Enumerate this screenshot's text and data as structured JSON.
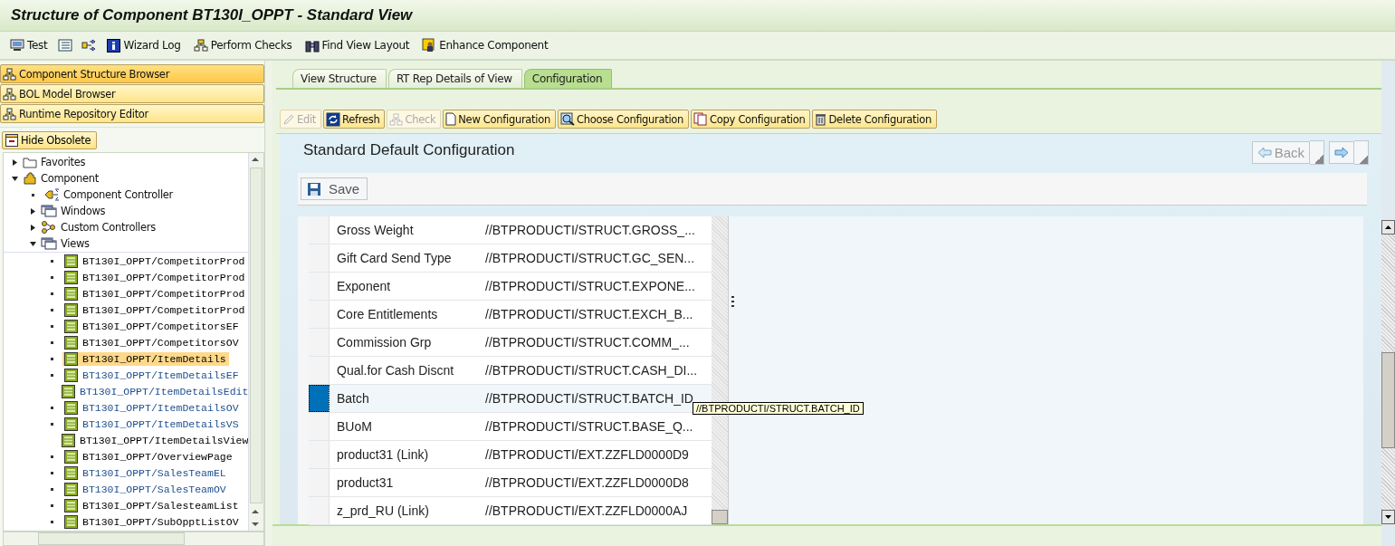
{
  "window": {
    "title": "Structure of Component BT130I_OPPT - Standard View"
  },
  "toolbar": [
    {
      "kind": "test",
      "label": "Test"
    },
    {
      "kind": "list"
    },
    {
      "kind": "flow"
    },
    {
      "kind": "info",
      "label": "Wizard Log"
    },
    {
      "kind": "checks",
      "label": "Perform Checks"
    },
    {
      "kind": "find",
      "label": "Find View Layout"
    },
    {
      "kind": "enhance",
      "label": "Enhance Component"
    }
  ],
  "nav": [
    {
      "label": "Component Structure Browser",
      "selected": true
    },
    {
      "label": "BOL Model Browser",
      "selected": false
    },
    {
      "label": "Runtime Repository Editor",
      "selected": false
    }
  ],
  "hide_button": {
    "label": "Hide Obsolete"
  },
  "tree": [
    {
      "label": "Favorites",
      "kind": "folder",
      "expanded": false
    },
    {
      "label": "Component",
      "kind": "component",
      "expanded": true,
      "children": [
        {
          "label": "Component Controller",
          "kind": "controller"
        },
        {
          "label": "Windows",
          "kind": "windows",
          "expanded": false
        },
        {
          "label": "Custom Controllers",
          "kind": "custom",
          "expanded": false
        },
        {
          "label": "Views",
          "kind": "windows",
          "expanded": true,
          "children": [
            {
              "label": "BT130I_OPPT/CompetitorProd",
              "kind": "view",
              "selected": false
            },
            {
              "label": "BT130I_OPPT/CompetitorProd",
              "kind": "view",
              "selected": false
            },
            {
              "label": "BT130I_OPPT/CompetitorProd",
              "kind": "view",
              "selected": false
            },
            {
              "label": "BT130I_OPPT/CompetitorProd",
              "kind": "view",
              "selected": false
            },
            {
              "label": "BT130I_OPPT/CompetitorsEF",
              "kind": "view",
              "selected": false
            },
            {
              "label": "BT130I_OPPT/CompetitorsOV",
              "kind": "view",
              "selected": false
            },
            {
              "label": "BT130I_OPPT/ItemDetails",
              "kind": "view",
              "selected": true
            },
            {
              "label": "BT130I_OPPT/ItemDetailsEF",
              "kind": "view_marked",
              "selected": false
            },
            {
              "label": "BT130I_OPPT/ItemDetailsEdit",
              "kind": "view_marked",
              "selected": false
            },
            {
              "label": "BT130I_OPPT/ItemDetailsOV",
              "kind": "view_marked",
              "selected": false
            },
            {
              "label": "BT130I_OPPT/ItemDetailsVS",
              "kind": "view_marked",
              "selected": false
            },
            {
              "label": "BT130I_OPPT/ItemDetailsView",
              "kind": "view",
              "selected": false
            },
            {
              "label": "BT130I_OPPT/OverviewPage",
              "kind": "view",
              "selected": false
            },
            {
              "label": "BT130I_OPPT/SalesTeamEL",
              "kind": "view_marked",
              "selected": false
            },
            {
              "label": "BT130I_OPPT/SalesTeamOV",
              "kind": "view_marked",
              "selected": false
            },
            {
              "label": "BT130I_OPPT/SalesteamList",
              "kind": "view",
              "selected": false
            },
            {
              "label": "BT130I_OPPT/SubOpptListOV",
              "kind": "view",
              "selected": false
            }
          ]
        }
      ]
    }
  ],
  "tabs": [
    {
      "label": "View Structure",
      "selected": false
    },
    {
      "label": "RT Rep Details of View",
      "selected": false
    },
    {
      "label": "Configuration",
      "selected": true
    }
  ],
  "config_buttons": [
    {
      "kind": "edit",
      "label": "Edit",
      "disabled": true
    },
    {
      "kind": "refresh",
      "label": "Refresh",
      "disabled": false
    },
    {
      "kind": "check",
      "label": "Check",
      "disabled": true
    },
    {
      "kind": "new",
      "label": "New Configuration",
      "disabled": false
    },
    {
      "kind": "choose",
      "label": "Choose Configuration",
      "disabled": false
    },
    {
      "kind": "copy",
      "label": "Copy Configuration",
      "disabled": false
    },
    {
      "kind": "delete",
      "label": "Delete Configuration",
      "disabled": false
    }
  ],
  "config": {
    "title": "Standard Default Configuration",
    "back": "Back",
    "save": "Save",
    "rows": [
      {
        "label": "Gross Weight",
        "field": "//BTPRODUCTI/STRUCT.GROSS_...",
        "selected": false
      },
      {
        "label": "Gift Card Send Type",
        "field": "//BTPRODUCTI/STRUCT.GC_SEN...",
        "selected": false
      },
      {
        "label": "Exponent",
        "field": "//BTPRODUCTI/STRUCT.EXPONE...",
        "selected": false
      },
      {
        "label": "Core Entitlements",
        "field": "//BTPRODUCTI/STRUCT.EXCH_B...",
        "selected": false
      },
      {
        "label": "Commission Grp",
        "field": "//BTPRODUCTI/STRUCT.COMM_...",
        "selected": false
      },
      {
        "label": "Qual.for Cash Discnt",
        "field": "//BTPRODUCTI/STRUCT.CASH_DI...",
        "selected": false
      },
      {
        "label": "Batch",
        "field": "//BTPRODUCTI/STRUCT.BATCH_ID",
        "selected": true
      },
      {
        "label": "BUoM",
        "field": "//BTPRODUCTI/STRUCT.BASE_Q...",
        "selected": false
      },
      {
        "label": "product31 (Link)",
        "field": "//BTPRODUCTI/EXT.ZZFLD0000D9",
        "selected": false
      },
      {
        "label": "product31",
        "field": "//BTPRODUCTI/EXT.ZZFLD0000D8",
        "selected": false
      },
      {
        "label": "z_prd_RU (Link)",
        "field": "//BTPRODUCTI/EXT.ZZFLD0000AJ",
        "selected": false
      }
    ],
    "tooltip": "//BTPRODUCTI/STRUCT.BATCH_ID"
  }
}
